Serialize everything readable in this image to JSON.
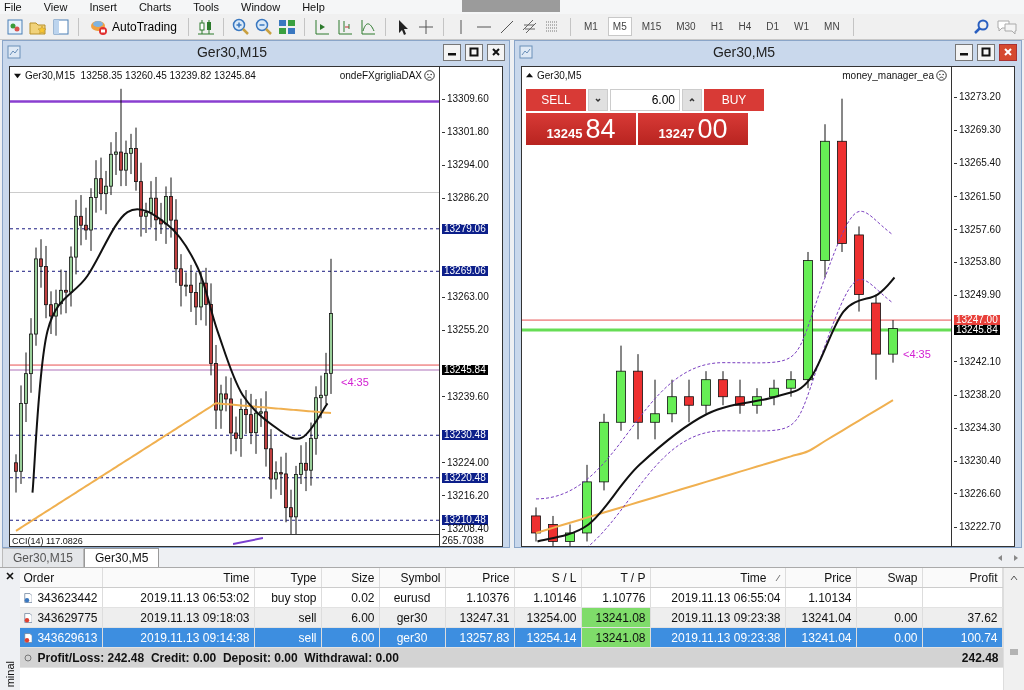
{
  "menu": [
    "File",
    "View",
    "Insert",
    "Charts",
    "Tools",
    "Window",
    "Help"
  ],
  "toolbar": {
    "autotrading": "AutoTrading",
    "timeframes": [
      {
        "label": "M1",
        "selected": false
      },
      {
        "label": "M5",
        "selected": true
      },
      {
        "label": "M15",
        "selected": false
      },
      {
        "label": "M30",
        "selected": false
      },
      {
        "label": "H1",
        "selected": false
      },
      {
        "label": "H4",
        "selected": false
      },
      {
        "label": "D1",
        "selected": false
      },
      {
        "label": "W1",
        "selected": false
      },
      {
        "label": "MN",
        "selected": false
      }
    ]
  },
  "charts": [
    {
      "title": "Ger30,M15",
      "active": false,
      "header": "Ger30,M15  13258.35 13260.45 13239.82 13245.84",
      "expert": "ondeFXgrigliaDAX",
      "countdown": "<4:35",
      "price_labels": [
        {
          "text": "13309.60",
          "kind": "tick"
        },
        {
          "text": "13301.80",
          "kind": "tick"
        },
        {
          "text": "13294.00",
          "kind": "tick"
        },
        {
          "text": "13286.20",
          "kind": "tick"
        },
        {
          "text": "13279.06",
          "kind": "level"
        },
        {
          "text": "13269.06",
          "kind": "level"
        },
        {
          "text": "13263.00",
          "kind": "tick"
        },
        {
          "text": "13255.20",
          "kind": "tick"
        },
        {
          "text": "13245.84",
          "kind": "bid"
        },
        {
          "text": "13239.60",
          "kind": "tick"
        },
        {
          "text": "13230.48",
          "kind": "level"
        },
        {
          "text": "13224.00",
          "kind": "tick"
        },
        {
          "text": "13220.48",
          "kind": "level"
        },
        {
          "text": "13216.20",
          "kind": "tick"
        },
        {
          "text": "13210.48",
          "kind": "level"
        },
        {
          "text": "13208.40",
          "kind": "tick"
        }
      ],
      "indicator": {
        "label": "CCI(14) 117.0826",
        "scale": "265.7038"
      }
    },
    {
      "title": "Ger30,M5",
      "active": true,
      "header": "Ger30,M5",
      "expert": "money_manager_ea",
      "countdown": "<4:35",
      "price_labels": [
        {
          "text": "13273.20",
          "kind": "tick"
        },
        {
          "text": "13269.30",
          "kind": "tick"
        },
        {
          "text": "13265.40",
          "kind": "tick"
        },
        {
          "text": "13261.50",
          "kind": "tick"
        },
        {
          "text": "13257.60",
          "kind": "tick"
        },
        {
          "text": "13253.80",
          "kind": "tick"
        },
        {
          "text": "13249.90",
          "kind": "tick"
        },
        {
          "text": "13247.00",
          "kind": "ask"
        },
        {
          "text": "13245.84",
          "kind": "bid"
        },
        {
          "text": "13242.10",
          "kind": "tick"
        },
        {
          "text": "13238.20",
          "kind": "tick"
        },
        {
          "text": "13234.30",
          "kind": "tick"
        },
        {
          "text": "13230.40",
          "kind": "tick"
        },
        {
          "text": "13226.60",
          "kind": "tick"
        },
        {
          "text": "13222.70",
          "kind": "tick"
        }
      ],
      "trade_panel": {
        "sell": "SELL",
        "buy": "BUY",
        "lot": "6.00",
        "sell_price_main": "13245",
        "sell_price_pips": "84",
        "buy_price_main": "13247",
        "buy_price_pips": "00"
      }
    }
  ],
  "chart_tabs": [
    {
      "label": "Ger30,M15",
      "selected": false
    },
    {
      "label": "Ger30,M5",
      "selected": true
    }
  ],
  "terminal": {
    "side_label": "minal",
    "columns": [
      "Order",
      "Time",
      "Type",
      "Size",
      "Symbol",
      "Price",
      "S / L",
      "T / P",
      "Time",
      "Price",
      "Swap",
      "Profit"
    ],
    "rows": [
      {
        "kind": "pending",
        "selected": false,
        "tp_highlight": false,
        "order": "343623442",
        "time": "2019.11.13 06:53:02",
        "type": "buy stop",
        "size": "0.02",
        "symbol": "eurusd",
        "price": "1.10376",
        "sl": "1.10146",
        "tp": "1.10776",
        "close_time": "2019.11.13 06:55:04",
        "close_price": "1.10134"
      },
      {
        "kind": "sell",
        "selected": false,
        "tp_highlight": true,
        "order": "343629775",
        "time": "2019.11.13 09:18:03",
        "type": "sell",
        "size": "6.00",
        "symbol": "ger30",
        "price": "13247.31",
        "sl": "13254.00",
        "tp": "13241.08",
        "close_time": "2019.11.13 09:23:38",
        "close_price": "13241.04",
        "swap": "0.00",
        "profit": "37.62"
      },
      {
        "kind": "sell",
        "selected": true,
        "tp_highlight": true,
        "order": "343629613",
        "time": "2019.11.13 09:14:38",
        "type": "sell",
        "size": "6.00",
        "symbol": "ger30",
        "price": "13257.83",
        "sl": "13254.14",
        "tp": "13241.08",
        "close_time": "2019.11.13 09:23:38",
        "close_price": "13241.04",
        "swap": "0.00",
        "profit": "100.74"
      }
    ],
    "summary": "Profit/Loss: 242.48  Credit: 0.00  Deposit: 0.00  Withdrawal: 0.00",
    "total": "242.48"
  }
}
